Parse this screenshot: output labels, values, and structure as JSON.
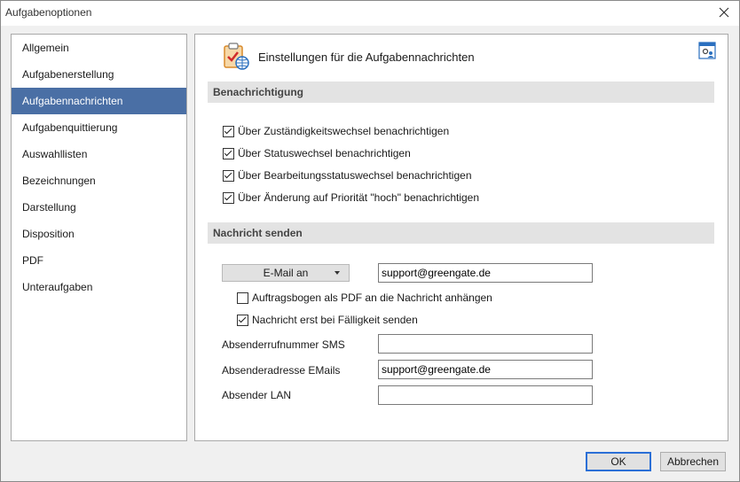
{
  "window": {
    "title": "Aufgabenoptionen"
  },
  "sidebar": {
    "items": [
      {
        "label": "Allgemein"
      },
      {
        "label": "Aufgabenerstellung"
      },
      {
        "label": "Aufgabennachrichten"
      },
      {
        "label": "Aufgabenquittierung"
      },
      {
        "label": "Auswahllisten"
      },
      {
        "label": "Bezeichnungen"
      },
      {
        "label": "Darstellung"
      },
      {
        "label": "Disposition"
      },
      {
        "label": "PDF"
      },
      {
        "label": "Unteraufgaben"
      }
    ],
    "active_index": 2
  },
  "panel": {
    "title": "Einstellungen für die Aufgabennachrichten",
    "sections": {
      "notify": "Benachrichtigung",
      "send": "Nachricht senden"
    },
    "notify_options": [
      {
        "label": "Über Zuständigkeitswechsel benachrichtigen",
        "checked": true
      },
      {
        "label": "Über Statuswechsel  benachrichtigen",
        "checked": true
      },
      {
        "label": "Über Bearbeitungsstatuswechsel  benachrichtigen",
        "checked": true
      },
      {
        "label": "Über Änderung auf Priorität \"hoch\" benachrichtigen",
        "checked": true
      }
    ],
    "send": {
      "dropdown_label": "E-Mail an",
      "email_value": "support@greengate.de",
      "attach_pdf": {
        "label": "Auftragsbogen als PDF an die Nachricht anhängen",
        "checked": false
      },
      "send_on_due": {
        "label": "Nachricht erst bei Fälligkeit senden",
        "checked": true
      },
      "sms_label": "Absenderrufnummer SMS",
      "sms_value": "",
      "email_sender_label": "Absenderadresse EMails",
      "email_sender_value": "support@greengate.de",
      "lan_label": "Absender LAN",
      "lan_value": ""
    }
  },
  "footer": {
    "ok_label": "OK",
    "cancel_label": "Abbrechen"
  }
}
